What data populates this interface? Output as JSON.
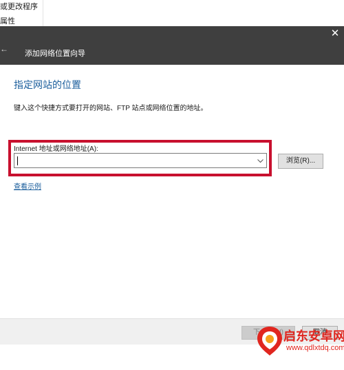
{
  "background": {
    "menu_items": [
      "或更改程序",
      "属性"
    ]
  },
  "titlebar": {
    "back_glyph": "←",
    "title": "添加网络位置向导",
    "close_glyph": "✕"
  },
  "main": {
    "heading": "指定网站的位置",
    "description": "键入这个快捷方式要打开的网站、FTP 站点或网络位置的地址。",
    "address_label": "Internet 地址或网络地址(A):",
    "address_value": "",
    "browse_label": "浏览(R)...",
    "example_link": "查看示例"
  },
  "footer": {
    "next_label": "下一步(N)",
    "cancel_label": "取消"
  },
  "watermark": {
    "name": "启东安卓网",
    "url": "www.qdlxtdq.com"
  },
  "colors": {
    "titlebar": "#3f3f3f",
    "heading": "#1b5e9c",
    "highlight": "#c8102e",
    "watermark": "#e0261f"
  }
}
